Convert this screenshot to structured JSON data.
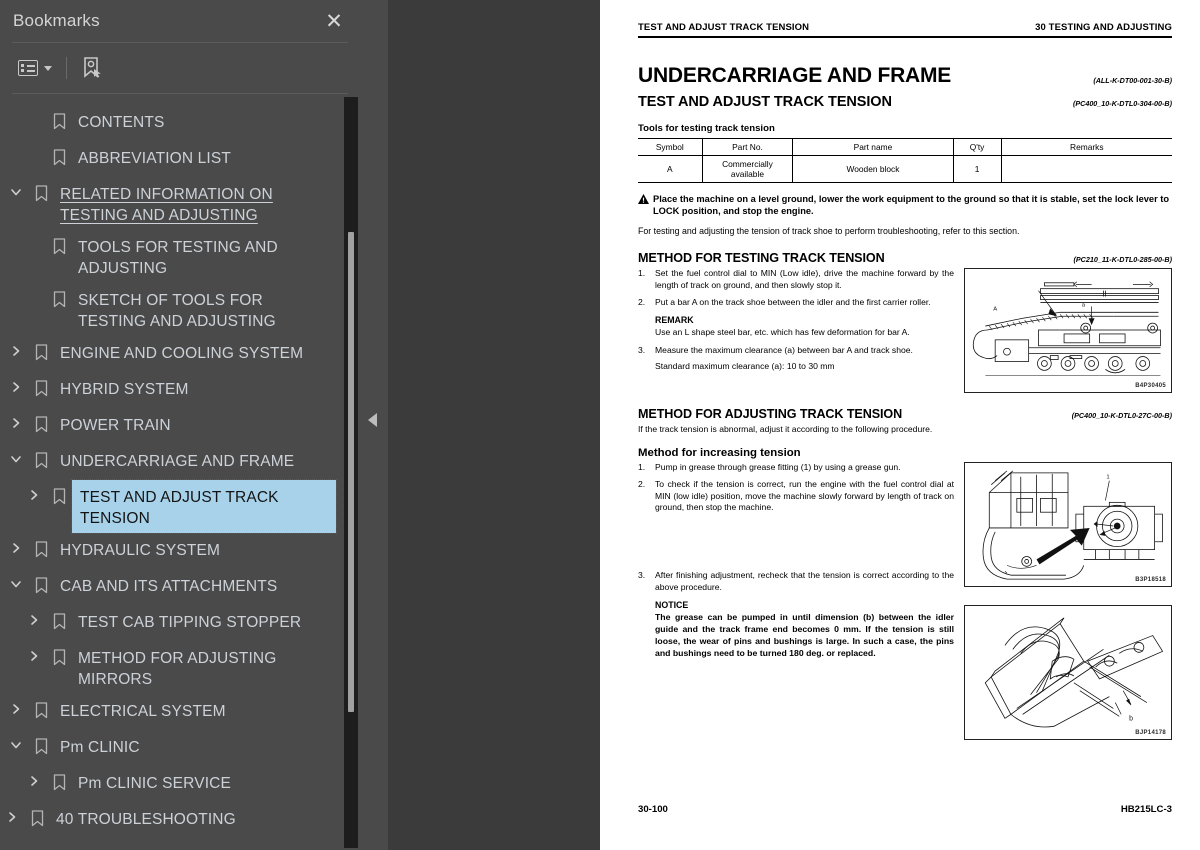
{
  "bookmarks_panel": {
    "title": "Bookmarks",
    "close_label": "✕",
    "toolbar": {
      "options_label": "",
      "find_bookmark_label": ""
    },
    "items": [
      {
        "label": "CONTENTS",
        "indent": 1,
        "chevron": "none",
        "state": "normal"
      },
      {
        "label": "ABBREVIATION LIST",
        "indent": 1,
        "chevron": "none",
        "state": "normal"
      },
      {
        "label": "RELATED INFORMATION ON TESTING AND ADJUSTING",
        "indent": 0,
        "chevron": "expanded",
        "state": "link"
      },
      {
        "label": "TOOLS FOR TESTING AND ADJUSTING",
        "indent": 1,
        "chevron": "none",
        "state": "normal"
      },
      {
        "label": "SKETCH OF TOOLS FOR TESTING AND ADJUSTING",
        "indent": 1,
        "chevron": "none",
        "state": "normal"
      },
      {
        "label": "ENGINE AND COOLING SYSTEM",
        "indent": 0,
        "chevron": "collapsed",
        "state": "normal"
      },
      {
        "label": "HYBRID SYSTEM",
        "indent": 0,
        "chevron": "collapsed",
        "state": "normal"
      },
      {
        "label": "POWER TRAIN",
        "indent": 0,
        "chevron": "collapsed",
        "state": "normal"
      },
      {
        "label": "UNDERCARRIAGE AND FRAME",
        "indent": 0,
        "chevron": "expanded",
        "state": "normal"
      },
      {
        "label": "TEST AND ADJUST TRACK TENSION",
        "indent": 1,
        "chevron": "collapsed",
        "state": "selected"
      },
      {
        "label": "HYDRAULIC SYSTEM",
        "indent": 0,
        "chevron": "collapsed",
        "state": "normal"
      },
      {
        "label": "CAB AND ITS ATTACHMENTS",
        "indent": 0,
        "chevron": "expanded",
        "state": "normal"
      },
      {
        "label": "TEST CAB TIPPING STOPPER",
        "indent": 1,
        "chevron": "collapsed",
        "state": "normal"
      },
      {
        "label": "METHOD FOR ADJUSTING MIRRORS",
        "indent": 1,
        "chevron": "collapsed",
        "state": "normal"
      },
      {
        "label": "ELECTRICAL SYSTEM",
        "indent": 0,
        "chevron": "collapsed",
        "state": "normal"
      },
      {
        "label": "Pm CLINIC",
        "indent": 0,
        "chevron": "expanded",
        "state": "normal"
      },
      {
        "label": "Pm CLINIC SERVICE",
        "indent": 1,
        "chevron": "collapsed",
        "state": "normal"
      },
      {
        "label": "40 TROUBLESHOOTING",
        "indent": -1,
        "chevron": "collapsed",
        "state": "normal"
      }
    ]
  },
  "document": {
    "running_head_left": "TEST AND ADJUST TRACK TENSION",
    "running_head_right": "30 TESTING AND ADJUSTING",
    "h1": "UNDERCARRIAGE AND FRAME",
    "h1_ref": "(ALL-K-DT00-001-30-B)",
    "h2": "TEST AND ADJUST TRACK TENSION",
    "h2_ref": "(PC400_10-K-DTL0-304-00-B)",
    "tools_caption": "Tools for testing track tension",
    "tools_table": {
      "headers": [
        "Symbol",
        "Part No.",
        "Part name",
        "Q'ty",
        "Remarks"
      ],
      "rows": [
        [
          "A",
          "Commercially available",
          "Wooden block",
          "1",
          ""
        ]
      ]
    },
    "warning_text": "Place the machine on a level ground, lower the work equipment to the ground so that it is stable, set the lock lever to LOCK position, and stop the engine.",
    "intro_text": "For testing and adjusting the tension of track shoe to perform troubleshooting, refer to this section.",
    "section_testing": {
      "heading": "METHOD FOR TESTING TRACK TENSION",
      "ref": "(PC210_11-K-DTL0-285-00-B)",
      "steps": [
        {
          "num": "1.",
          "text": "Set the fuel control dial to MIN (Low idle), drive the machine forward by the length of track on ground, and then slowly stop it."
        },
        {
          "num": "2.",
          "text": "Put a bar A on the track shoe between the idler and the first carrier roller."
        }
      ],
      "remark_heading": "REMARK",
      "remark_text": "Use an L shape steel bar, etc. which has few deformation for bar A.",
      "step3": {
        "num": "3.",
        "text": "Measure the maximum clearance (a) between bar A and track shoe."
      },
      "standard_line": "Standard maximum clearance (a): 10 to 30 mm",
      "figure_id": "B4P30405"
    },
    "section_adjusting": {
      "heading": "METHOD FOR ADJUSTING TRACK TENSION",
      "ref": "(PC400_10-K-DTL0-27C-00-B)",
      "intro": "If the track tension is abnormal, adjust it according to the following procedure.",
      "subheading": "Method for increasing tension",
      "steps": [
        {
          "num": "1.",
          "text": "Pump in grease through grease fitting (1) by using a grease gun."
        },
        {
          "num": "2.",
          "text": "To check if the tension is correct, run the engine with the fuel control dial at MIN (low idle) position, move the machine slowly forward by length of track on ground, then stop the machine."
        }
      ],
      "figure_id": "B3P18518",
      "step3": {
        "num": "3.",
        "text": "After finishing adjustment, recheck that the tension is correct according to the above procedure."
      },
      "notice_heading": "NOTICE",
      "notice_text": "The grease can be pumped in until dimension (b) between the idler guide and the track frame end becomes 0 mm. If the tension is still loose, the wear of pins and bushings is large. In such a case, the pins and bushings need to be turned 180 deg. or replaced.",
      "figure_id2": "BJP14178"
    },
    "footer_left": "30-100",
    "footer_right": "HB215LC-3"
  },
  "colors": {
    "panel_bg": "#4a4a4a",
    "app_bg": "#3b3b3b",
    "selection": "#a8d2ea",
    "text": "#ccd2d8"
  }
}
